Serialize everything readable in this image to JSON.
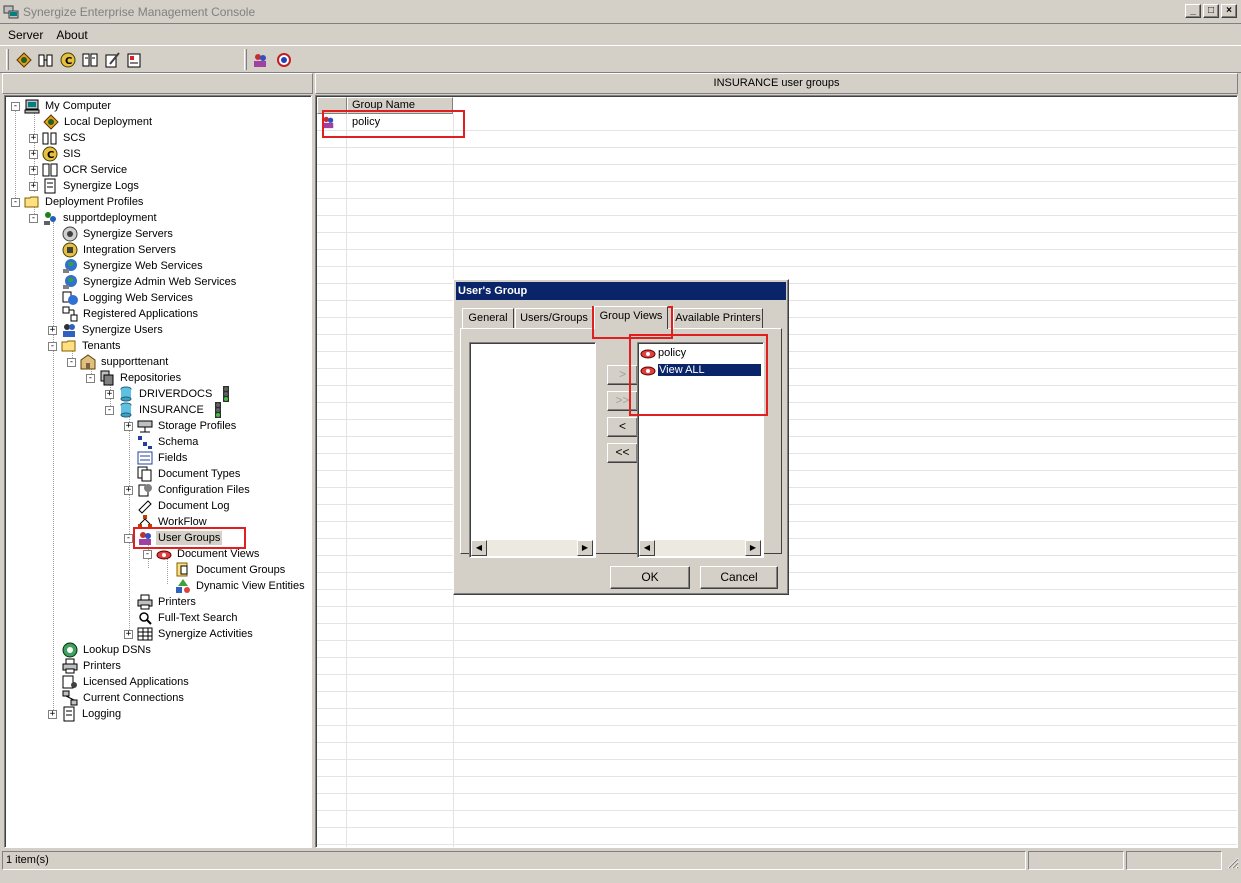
{
  "window": {
    "title": "Synergize Enterprise Management Console"
  },
  "menu": [
    {
      "label": "Server"
    },
    {
      "label": "About"
    }
  ],
  "toolbar": {
    "icons": [
      "deploy-icon",
      "scs-icon",
      "sis-icon",
      "ocr-icon",
      "logs-icon",
      "profiles-icon",
      "users-icon",
      "connections-icon"
    ]
  },
  "right_header": "INSURANCE user groups",
  "tree": [
    {
      "label": "My Computer"
    },
    {
      "label": "Local Deployment"
    },
    {
      "label": "SCS"
    },
    {
      "label": "SIS"
    },
    {
      "label": "OCR Service"
    },
    {
      "label": "Synergize Logs"
    },
    {
      "label": "Deployment Profiles"
    },
    {
      "label": "supportdeployment"
    },
    {
      "label": "Synergize Servers"
    },
    {
      "label": "Integration Servers"
    },
    {
      "label": "Synergize Web Services"
    },
    {
      "label": "Synergize Admin Web Services"
    },
    {
      "label": "Logging Web Services"
    },
    {
      "label": "Registered Applications"
    },
    {
      "label": "Synergize Users"
    },
    {
      "label": "Tenants"
    },
    {
      "label": "supporttenant"
    },
    {
      "label": "Repositories"
    },
    {
      "label": "DRIVERDOCS"
    },
    {
      "label": "INSURANCE"
    },
    {
      "label": "Storage Profiles"
    },
    {
      "label": "Schema"
    },
    {
      "label": "Fields"
    },
    {
      "label": "Document Types"
    },
    {
      "label": "Configuration Files"
    },
    {
      "label": "Document Log"
    },
    {
      "label": "WorkFlow"
    },
    {
      "label": "User Groups"
    },
    {
      "label": "Document Views"
    },
    {
      "label": "Document Groups"
    },
    {
      "label": "Dynamic View Entities"
    },
    {
      "label": "Printers"
    },
    {
      "label": "Full-Text Search"
    },
    {
      "label": "Synergize Activities"
    },
    {
      "label": "Lookup DSNs"
    },
    {
      "label": "Printers"
    },
    {
      "label": "Licensed Applications"
    },
    {
      "label": "Current Connections"
    },
    {
      "label": "Logging"
    }
  ],
  "list": {
    "column": "Group Name",
    "rows": [
      {
        "name": "policy"
      }
    ]
  },
  "dialog": {
    "title": "User's Group",
    "tabs": [
      "General",
      "Users/Groups",
      "Group Views",
      "Available Printers"
    ],
    "active_tab": "Group Views",
    "available_views": [],
    "assigned_views": [
      {
        "label": "policy"
      },
      {
        "label": "View ALL",
        "selected": true
      }
    ],
    "move_buttons": [
      ">",
      ">>",
      "<",
      "<<"
    ],
    "ok": "OK",
    "cancel": "Cancel"
  },
  "status": {
    "text": "1 item(s)"
  },
  "colors": {
    "highlight": "#0a246a",
    "annotation": "#e02020",
    "face": "#d4d0c8"
  }
}
